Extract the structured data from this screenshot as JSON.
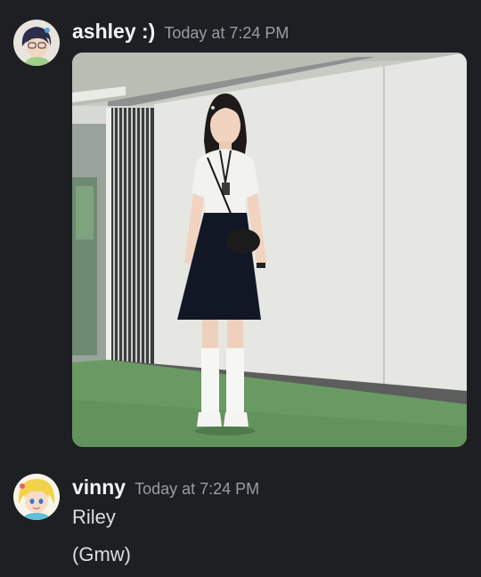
{
  "messages": [
    {
      "author": "ashley :)",
      "timestamp": "Today at 7:24 PM",
      "avatar": "anime-girl-avatar",
      "attachment": "photo of a girl in school uniform standing in a white room with green floor"
    },
    {
      "author": "vinny",
      "timestamp": "Today at 7:24 PM",
      "avatar": "blonde-anime-avatar",
      "lines": [
        "Riley",
        "(Gmw)"
      ]
    }
  ],
  "colors": {
    "background": "#1e1f23",
    "username": "#f2f3f5",
    "timestamp": "#9a9ca3",
    "message_text": "#dcdde1"
  }
}
